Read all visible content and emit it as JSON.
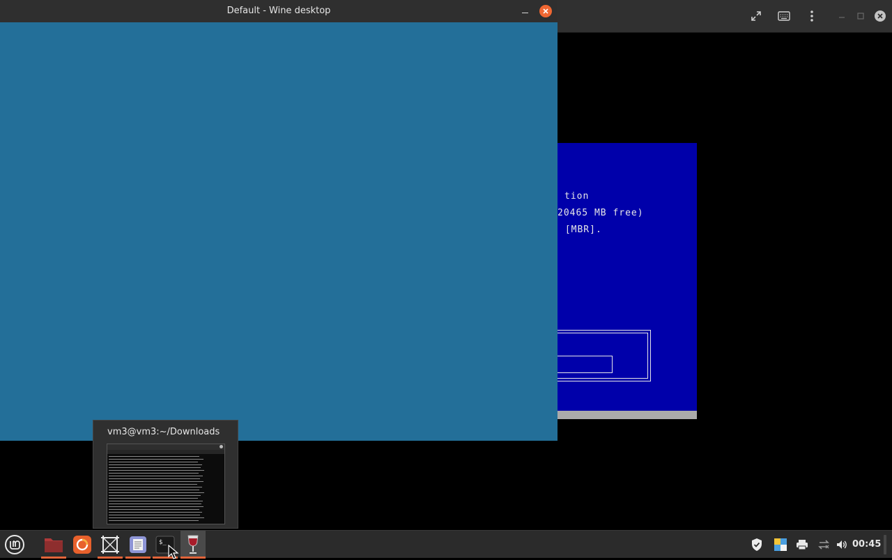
{
  "vm_viewer": {
    "toolbar_icons": [
      "fullscreen-icon",
      "keyboard-icon",
      "menu-icon",
      "minimize-icon",
      "maximize-icon",
      "close-icon"
    ],
    "console": {
      "lines": [
        "tion",
        "20465 MB free)",
        " [MBR]."
      ],
      "background": "#0000aa"
    }
  },
  "wine_window": {
    "title": "Default - Wine desktop",
    "desktop_color": "#236f99",
    "close_color": "#f06732"
  },
  "preview": {
    "title": "vm3@vm3:~/Downloads"
  },
  "taskbar": {
    "apps": [
      "mint-menu-icon",
      "files-icon",
      "firefox-icon",
      "screenshot-icon",
      "text-editor-icon",
      "terminal-icon",
      "wine-icon"
    ],
    "tray": [
      "shield-icon",
      "color-palette-icon",
      "printer-icon",
      "network-icon",
      "volume-icon"
    ],
    "clock": "00:45",
    "accent": "#e2643a"
  }
}
